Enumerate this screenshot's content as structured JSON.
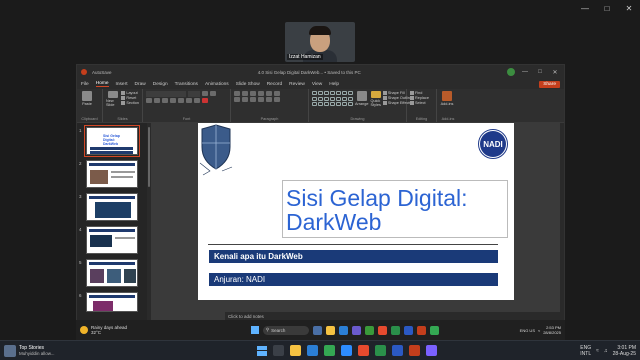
{
  "video": {
    "participant_name": "Izzat Hamizan"
  },
  "window": {
    "autosave": "AutoSave",
    "title": "4.0 Sisi Gelap Digital DarkWeb...  •  Saved to this PC",
    "controls": [
      "—",
      "□",
      "✕"
    ]
  },
  "tabs": [
    "File",
    "Home",
    "Insert",
    "Draw",
    "Design",
    "Transitions",
    "Animations",
    "Slide Show",
    "Record",
    "Review",
    "View",
    "Help"
  ],
  "share_label": "Share",
  "ribbon": {
    "groups": [
      "Clipboard",
      "Slides",
      "Font",
      "Paragraph",
      "Drawing",
      "Editing",
      "Add-ins"
    ],
    "paste": "Paste",
    "new_slide": "New Slide",
    "layout": "Layout",
    "reset": "Reset",
    "section": "Section",
    "arrange": "Arrange",
    "quick_styles": "Quick Styles",
    "shape_fill": "Shape Fill",
    "shape_outline": "Shape Outline",
    "shape_effects": "Shape Effects",
    "find": "Find",
    "replace": "Replace",
    "select": "Select",
    "addins": "Add-ins"
  },
  "thumbnails": [
    {
      "num": "1",
      "title": "Sisi Gelap Digital: DarkWeb"
    },
    {
      "num": "2",
      "title": ""
    },
    {
      "num": "3",
      "title": ""
    },
    {
      "num": "4",
      "title": ""
    },
    {
      "num": "5",
      "title": ""
    },
    {
      "num": "6",
      "title": ""
    }
  ],
  "slide": {
    "logo": "NADI",
    "title": "Sisi Gelap Digital: DarkWeb",
    "banner1": "Kenali apa itu DarkWeb",
    "banner2": "Anjuran: NADI"
  },
  "notes_placeholder": "Click to add notes",
  "status": {
    "slide_count": "Slide 1 of 10",
    "language": "English (Malaysia)",
    "accessibility": "Accessibility: Good to go",
    "zoom": "70%"
  },
  "inner_taskbar": {
    "weather_temp": "32°C",
    "weather_desc": "Rainy days ahead",
    "search": "Search",
    "lang": "ENG US",
    "time": "2:53 PM",
    "date": "28/8/2025"
  },
  "outer_taskbar": {
    "news_title": "Top Stories",
    "news_sub": "Muhyiddin allow...",
    "lang1": "ENG",
    "lang2": "INTL",
    "time": "3:01 PM",
    "date": "28-Aug-25"
  }
}
